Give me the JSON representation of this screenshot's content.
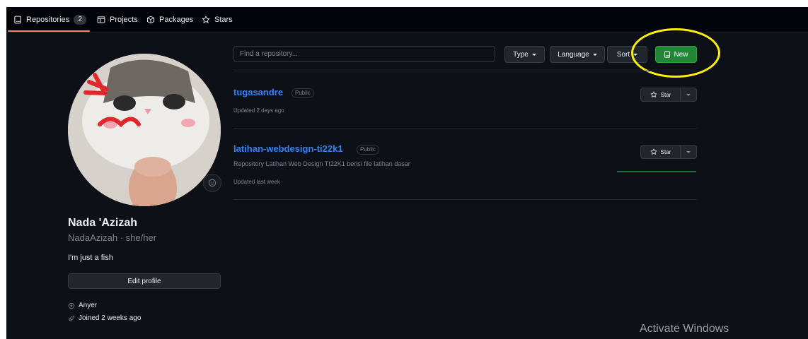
{
  "nav": {
    "repositories_label": "Repositories",
    "repositories_count": "2",
    "projects_label": "Projects",
    "packages_label": "Packages",
    "stars_label": "Stars"
  },
  "profile": {
    "full_name": "Nada 'Azizah",
    "login_line": "NadaAzizah · she/her",
    "bio": "I'm just a fish",
    "edit_profile_label": "Edit profile",
    "location": "Anyer",
    "joined": "Joined 2 weeks ago"
  },
  "toolbar": {
    "search_placeholder": "Find a repository...",
    "type_label": "Type",
    "language_label": "Language",
    "sort_label": "Sort",
    "new_label": "New"
  },
  "repos": [
    {
      "name": "tugasandre",
      "visibility": "Public",
      "description": "",
      "updated": "Updated 2 days ago",
      "star_label": "Star"
    },
    {
      "name": "latihan-webdesign-ti22k1",
      "visibility": "Public",
      "description": "Repository Latihan Web Design TI22K1 berisi file latihan dasar",
      "updated": "Updated last week",
      "star_label": "Star"
    }
  ],
  "watermark": "Activate Windows",
  "colors": {
    "background": "#0d1117",
    "link": "#2f81f7",
    "primary_button": "#238636",
    "active_tab_underline": "#f78166",
    "annotation_circle": "#fff200"
  },
  "icons": {
    "repositories": "repo-icon",
    "projects": "table-icon",
    "packages": "package-icon",
    "stars": "star-icon",
    "location": "location-icon",
    "joined": "rocket-icon",
    "status": "smiley-icon"
  }
}
